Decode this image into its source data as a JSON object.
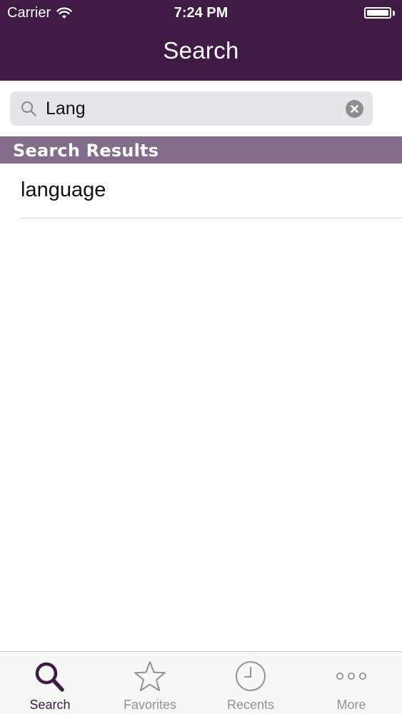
{
  "status_bar": {
    "carrier": "Carrier",
    "time": "7:24 PM",
    "wifi_icon": "wifi-icon",
    "battery_icon": "battery-full-icon"
  },
  "nav": {
    "title": "Search"
  },
  "search": {
    "value": "Lang",
    "icon": "magnifier-icon",
    "clear_icon": "clear-circle-icon"
  },
  "results": {
    "header": "Search Results",
    "items": [
      {
        "label": "language"
      }
    ]
  },
  "tabbar": {
    "tabs": [
      {
        "label": "Search",
        "icon": "search-icon",
        "active": true
      },
      {
        "label": "Favorites",
        "icon": "star-icon",
        "active": false
      },
      {
        "label": "Recents",
        "icon": "clock-icon",
        "active": false
      },
      {
        "label": "More",
        "icon": "more-dots-icon",
        "active": false
      }
    ]
  },
  "colors": {
    "brand": "#3e1a44",
    "section_header": "#826b8b",
    "search_field": "#e6e6ea",
    "tab_inactive": "#929292"
  }
}
